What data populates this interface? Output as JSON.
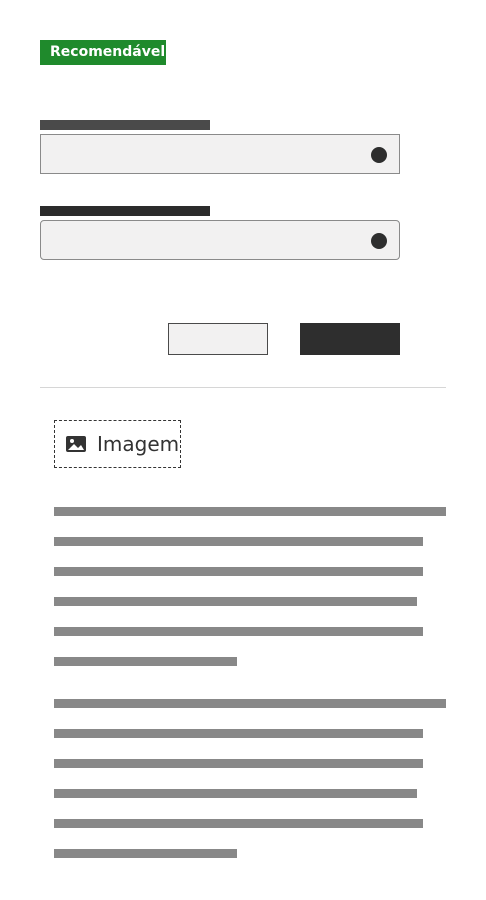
{
  "badge": {
    "label": "Recomendável",
    "color": "#1f8a2c"
  },
  "form": {
    "fields": [
      {
        "label_placeholder": true,
        "indicator_icon": "dot-icon"
      },
      {
        "label_placeholder": true,
        "indicator_icon": "dot-icon"
      }
    ],
    "buttons": {
      "secondary_label": "",
      "primary_label": ""
    }
  },
  "image_placeholder": {
    "label": "Imagem",
    "icon": "image-icon"
  },
  "text_placeholder": {
    "paragraph_count": 2,
    "lines_per_paragraph": 6
  }
}
